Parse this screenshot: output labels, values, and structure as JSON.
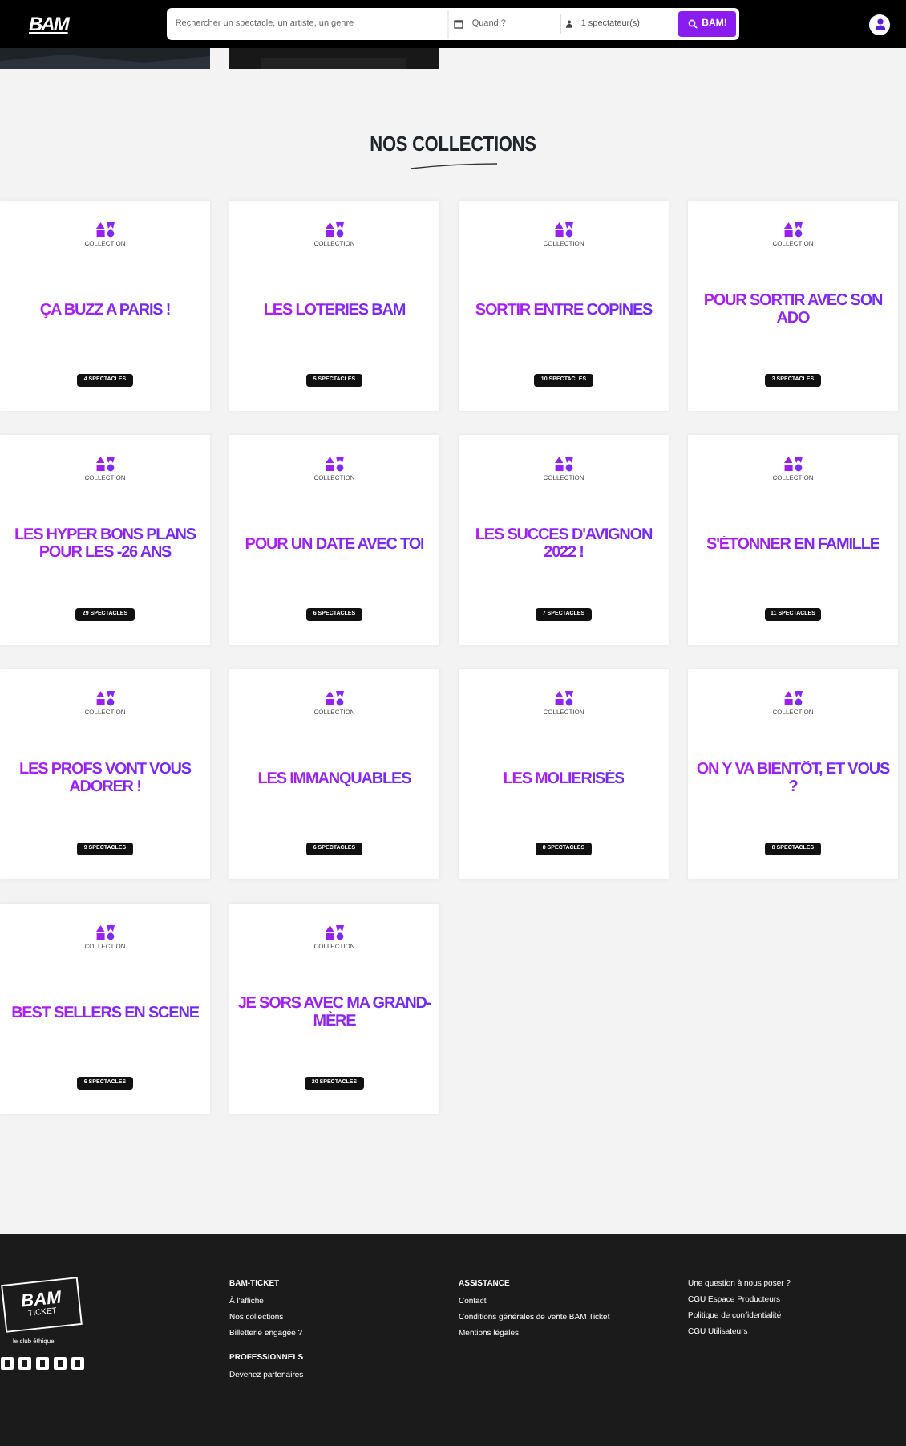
{
  "header": {
    "logo": "BAM",
    "search": {
      "placeholder": "Rechercher un spectacle, un artiste, un genre"
    },
    "date": {
      "placeholder": "Quand ?"
    },
    "guests": {
      "value": "1 spectateur(s)"
    },
    "button": "BAM!"
  },
  "section_title": "NOS COLLECTIONS",
  "collections": [
    {
      "tag": "COLLECTION",
      "title": "ÇA BUZZ A PARIS !",
      "count": "4 SPECTACLES"
    },
    {
      "tag": "COLLECTION",
      "title": "LES LOTERIES BAM",
      "count": "5 SPECTACLES"
    },
    {
      "tag": "COLLECTION",
      "title": "SORTIR ENTRE COPINES",
      "count": "10 SPECTACLES"
    },
    {
      "tag": "COLLECTION",
      "title": "POUR SORTIR AVEC SON ADO",
      "count": "3 SPECTACLES"
    },
    {
      "tag": "COLLECTION",
      "title": "LES HYPER BONS PLANS POUR LES -26 ANS",
      "count": "29 SPECTACLES"
    },
    {
      "tag": "COLLECTION",
      "title": "POUR UN DATE AVEC TOI",
      "count": "6 SPECTACLES"
    },
    {
      "tag": "COLLECTION",
      "title": "LES SUCCES D'AVIGNON 2022 !",
      "count": "7 SPECTACLES"
    },
    {
      "tag": "COLLECTION",
      "title": "S'ÉTONNER EN FAMILLE",
      "count": "11 SPECTACLES"
    },
    {
      "tag": "COLLECTION",
      "title": "LES PROFS VONT VOUS ADORER !",
      "count": "9 SPECTACLES"
    },
    {
      "tag": "COLLECTION",
      "title": "LES IMMANQUABLES",
      "count": "6 SPECTACLES"
    },
    {
      "tag": "COLLECTION",
      "title": "LES MOLIERISÉS",
      "count": "8 SPECTACLES"
    },
    {
      "tag": "COLLECTION",
      "title": "ON Y VA BIENTÔT, ET VOUS ?",
      "count": "8 SPECTACLES"
    },
    {
      "tag": "COLLECTION",
      "title": "BEST SELLERS EN SCENE",
      "count": "6 SPECTACLES"
    },
    {
      "tag": "COLLECTION",
      "title": "JE SORS AVEC MA GRAND-MÈRE",
      "count": "20 SPECTACLES"
    }
  ],
  "footer": {
    "logo": "BAM",
    "logo_sub": "TICKET",
    "tagline": "le club éthique",
    "columns": [
      {
        "heading": "BAM-TICKET",
        "links": [
          "À l'affiche",
          "Nos collections",
          "Billetterie engagée ?"
        ]
      },
      {
        "heading": "PROFESSIONNELS",
        "links": [
          "Devenez partenaires"
        ]
      },
      {
        "heading": "ASSISTANCE",
        "links": [
          "Contact",
          "Conditions générales de vente BAM Ticket",
          "Mentions légales"
        ]
      },
      {
        "links": [
          "Une question à nous poser ?",
          "CGU Espace Producteurs",
          "Politique de confidentialité",
          "CGU Utilisateurs"
        ]
      }
    ]
  }
}
